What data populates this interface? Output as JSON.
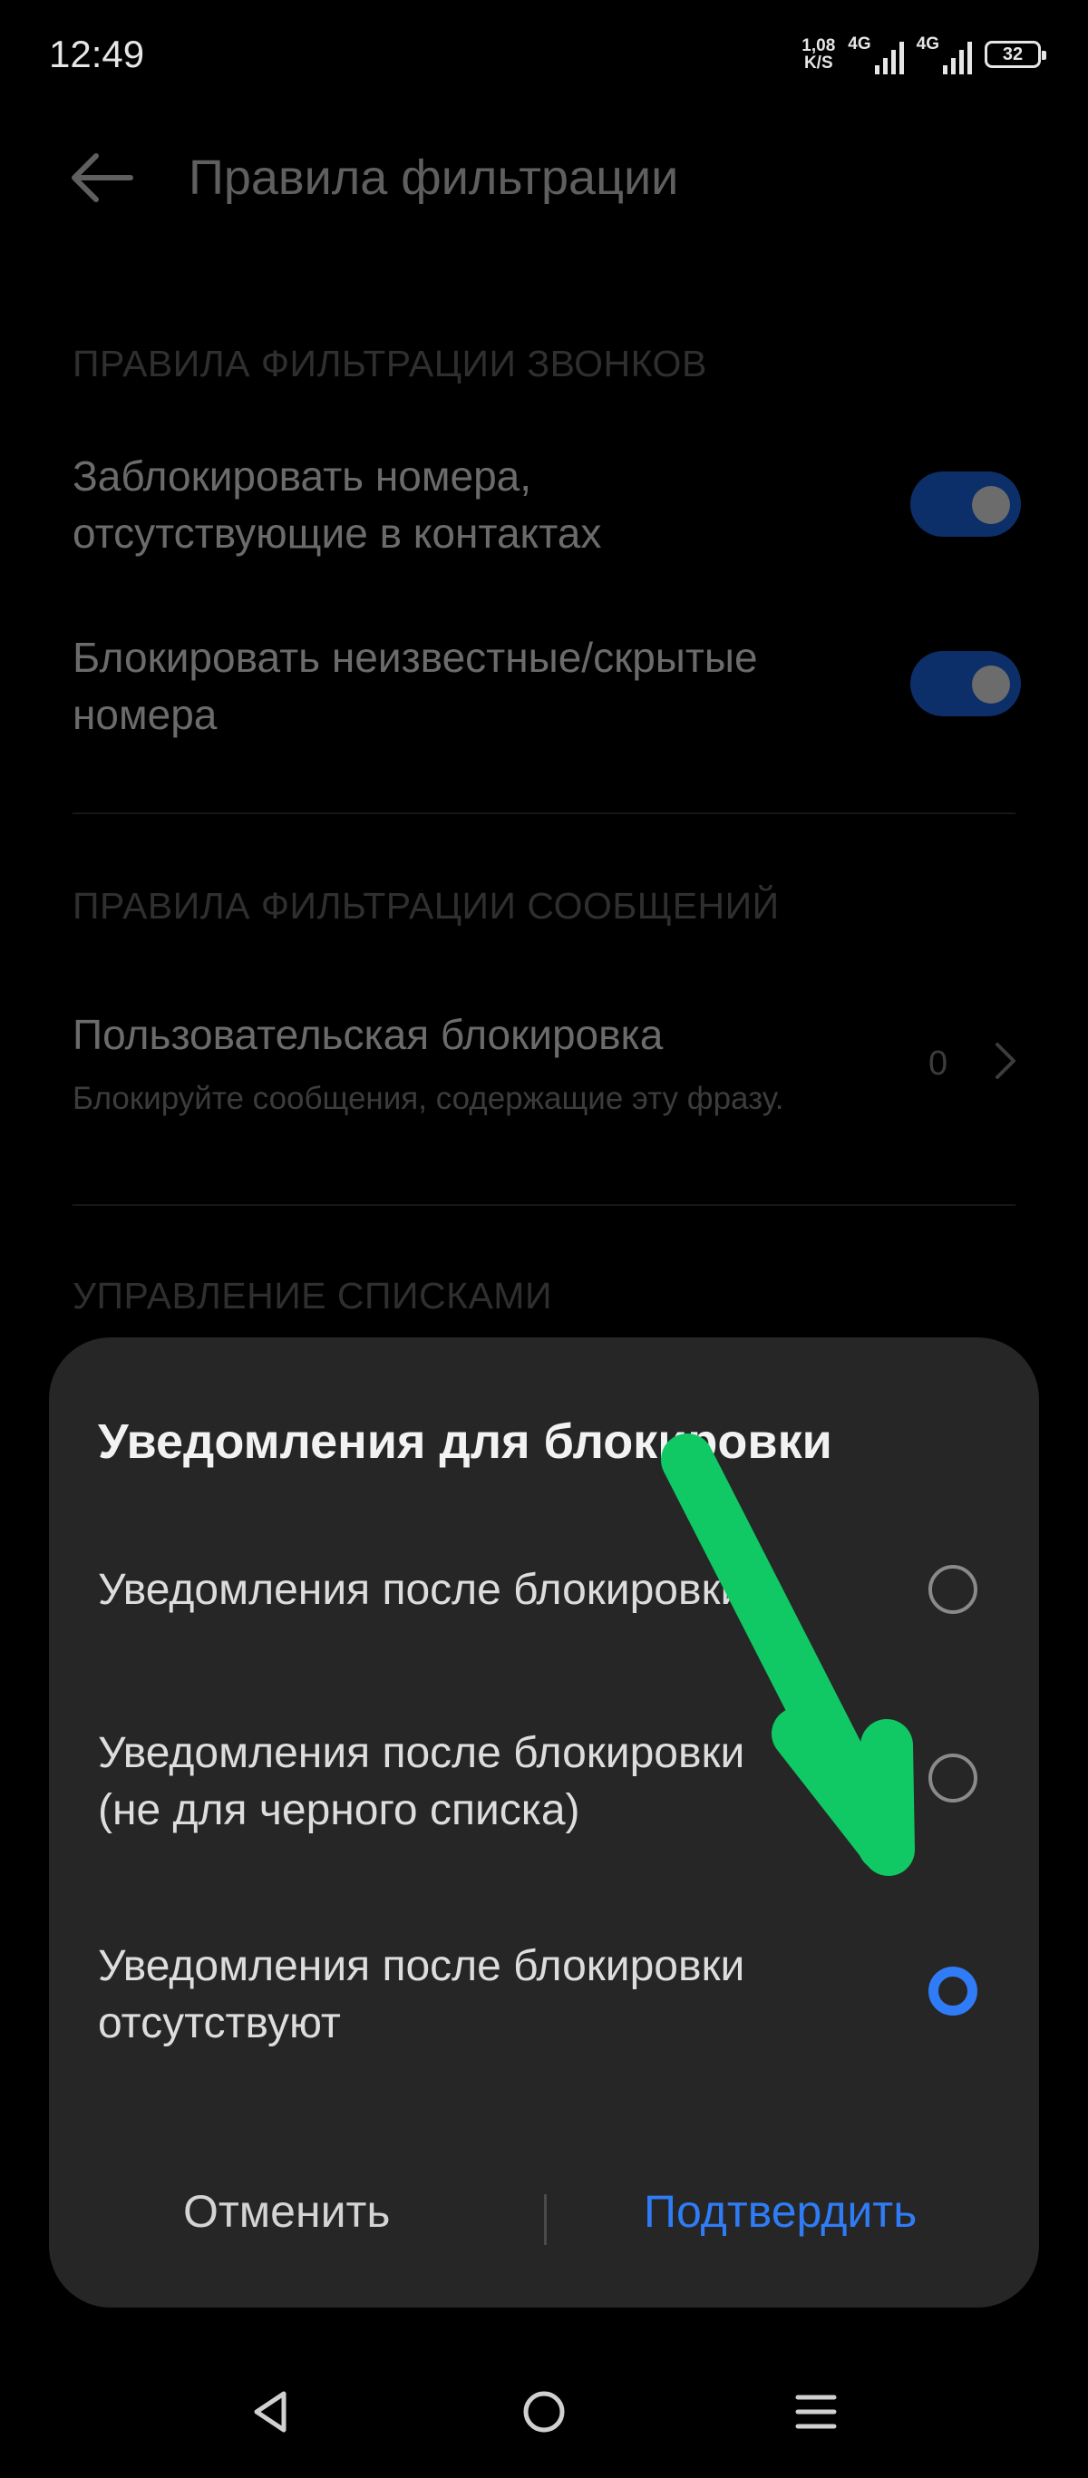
{
  "status_bar": {
    "time": "12:49",
    "speed_value": "1,08",
    "speed_unit": "K/S",
    "network_1": "4G",
    "network_2": "4G",
    "battery": "32"
  },
  "header": {
    "back_icon": "arrow-left-icon",
    "title": "Правила фильтрации"
  },
  "call_rules": {
    "section_label": "ПРАВИЛА ФИЛЬТРАЦИИ ЗВОНКОВ",
    "items": [
      {
        "label_line1": "Заблокировать номера,",
        "label_line2": "отсутствующие в контактах",
        "enabled": true
      },
      {
        "label_line1": "Блокировать неизвестные/скрытые",
        "label_line2": "номера",
        "enabled": true
      }
    ]
  },
  "message_rules": {
    "section_label": "ПРАВИЛА ФИЛЬТРАЦИИ СООБЩЕНИЙ",
    "custom_block": {
      "title": "Пользовательская блокировка",
      "subtitle": "Блокируйте сообщения, содержащие эту фразу.",
      "count": "0"
    }
  },
  "list_management": {
    "section_label": "УПРАВЛЕНИЕ СПИСКАМИ"
  },
  "dialog": {
    "title": "Уведомления для блокировки",
    "options": [
      {
        "line1": "Уведомления после блокировки",
        "line2": "",
        "selected": false
      },
      {
        "line1": "Уведомления после блокировки",
        "line2": "(не для черного списка)",
        "selected": false
      },
      {
        "line1": "Уведомления после блокировки",
        "line2": "отсутствуют",
        "selected": true
      }
    ],
    "cancel_label": "Отменить",
    "confirm_label": "Подтвердить"
  },
  "colors": {
    "accent": "#2f7cf6",
    "annotation_arrow": "#10c964",
    "dialog_bg": "#262626"
  },
  "nav_bar": {
    "back_icon": "triangle-back-icon",
    "home_icon": "circle-home-icon",
    "menu_icon": "menu-lines-icon"
  }
}
